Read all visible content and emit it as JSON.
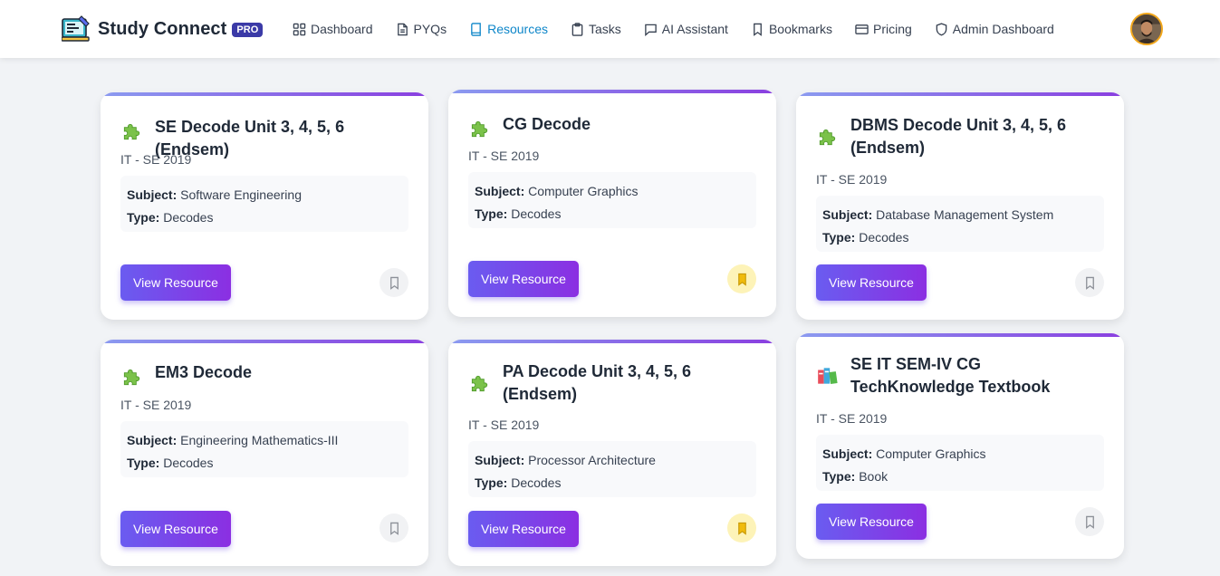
{
  "brand": {
    "name": "Study Connect",
    "badge": "PRO"
  },
  "nav": [
    {
      "label": "Dashboard",
      "icon": "grid-icon"
    },
    {
      "label": "PYQs",
      "icon": "document-icon"
    },
    {
      "label": "Resources",
      "icon": "book-icon",
      "active": true
    },
    {
      "label": "Tasks",
      "icon": "clipboard-icon"
    },
    {
      "label": "AI Assistant",
      "icon": "chat-icon"
    },
    {
      "label": "Bookmarks",
      "icon": "bookmark-icon"
    },
    {
      "label": "Pricing",
      "icon": "credit-card-icon"
    },
    {
      "label": "Admin Dashboard",
      "icon": "shield-icon"
    }
  ],
  "colors": {
    "accent": "#0e86c9",
    "button_from": "#6a5cf0",
    "button_to": "#8b2fe2",
    "bookmark_active": "#f0bb0c"
  },
  "cards": [
    {
      "title": "SE Decode Unit 3, 4, 5, 6 (Endsem)",
      "meta": "IT - SE 2019",
      "subject_label": "Subject:",
      "subject": "Software Engineering",
      "type_label": "Type:",
      "type": "Decodes",
      "button": "View Resource",
      "bookmarked": false,
      "icon": "puzzle-icon"
    },
    {
      "title": "CG Decode",
      "meta": "IT - SE 2019",
      "subject_label": "Subject:",
      "subject": "Computer Graphics",
      "type_label": "Type:",
      "type": "Decodes",
      "button": "View Resource",
      "bookmarked": true,
      "icon": "puzzle-icon"
    },
    {
      "title": "DBMS Decode Unit 3, 4, 5, 6 (Endsem)",
      "meta": "IT - SE 2019",
      "subject_label": "Subject:",
      "subject": "Database Management System",
      "type_label": "Type:",
      "type": "Decodes",
      "button": "View Resource",
      "bookmarked": false,
      "icon": "puzzle-icon"
    },
    {
      "title": "EM3 Decode",
      "meta": "IT - SE 2019",
      "subject_label": "Subject:",
      "subject": "Engineering Mathematics-III",
      "type_label": "Type:",
      "type": "Decodes",
      "button": "View Resource",
      "bookmarked": false,
      "icon": "puzzle-icon"
    },
    {
      "title": "PA Decode Unit 3, 4, 5, 6 (Endsem)",
      "meta": "IT - SE 2019",
      "subject_label": "Subject:",
      "subject": "Processor Architecture",
      "type_label": "Type:",
      "type": "Decodes",
      "button": "View Resource",
      "bookmarked": true,
      "icon": "puzzle-icon"
    },
    {
      "title": "SE IT SEM-IV CG TechKnowledge Textbook",
      "meta": "IT - SE 2019",
      "subject_label": "Subject:",
      "subject": "Computer Graphics",
      "type_label": "Type:",
      "type": "Book",
      "button": "View Resource",
      "bookmarked": false,
      "icon": "books-icon"
    }
  ]
}
